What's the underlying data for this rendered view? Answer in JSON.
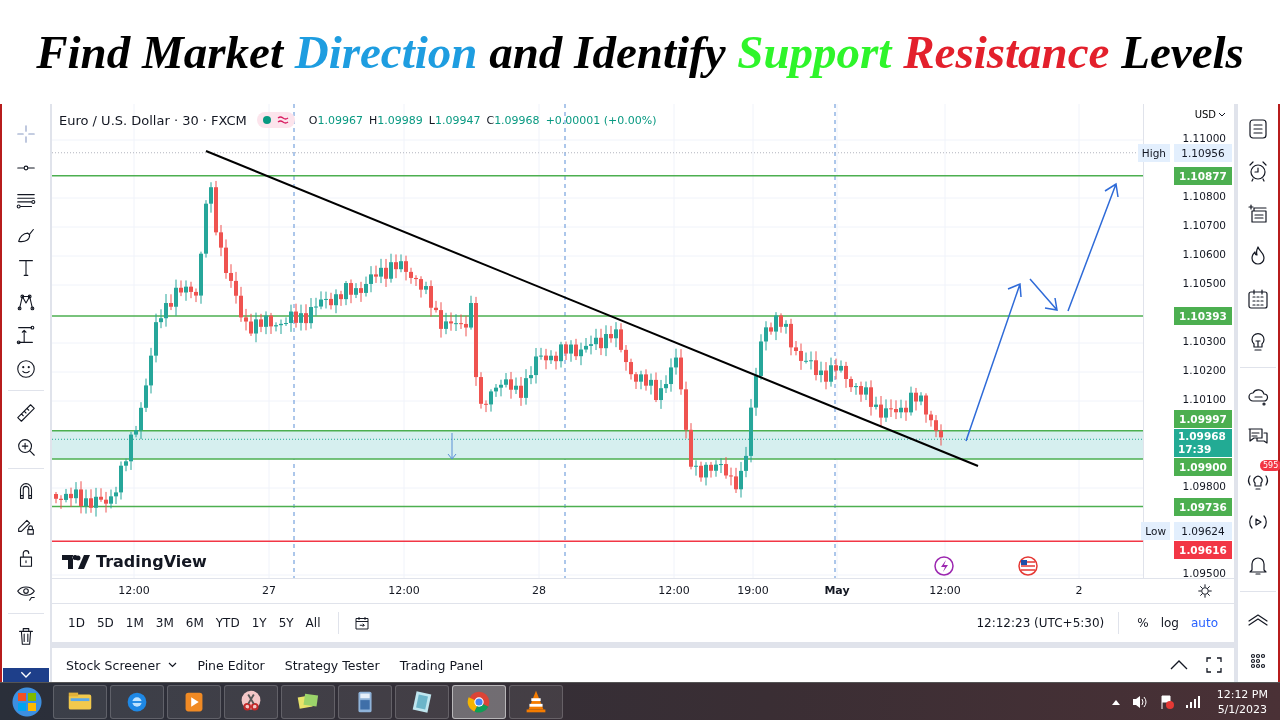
{
  "headline": [
    {
      "text": "Find Market",
      "color": "#000000"
    },
    {
      "text": "Direction",
      "color": "#1e9de0"
    },
    {
      "text": "and Identify",
      "color": "#000000"
    },
    {
      "text": "Support",
      "color": "#2ef52a"
    },
    {
      "text": "Resistance",
      "color": "#e3202c"
    },
    {
      "text": "Levels",
      "color": "#000000"
    }
  ],
  "chart": {
    "symbol": "Euro / U.S. Dollar · 30 · FXCM",
    "ohlc": [
      {
        "label": "O",
        "value": "1.09967"
      },
      {
        "label": "H",
        "value": "1.09989"
      },
      {
        "label": "L",
        "value": "1.09947"
      },
      {
        "label": "C",
        "value": "1.09968"
      }
    ],
    "change": "+0.00001 (+0.00%)",
    "currency": "USD",
    "logo": "TradingView",
    "price_ticks": [
      "1.11000",
      "1.10800",
      "1.10700",
      "1.10600",
      "1.10500",
      "1.10300",
      "1.10200",
      "1.10100",
      "1.09800",
      "1.09500"
    ],
    "price_labels": [
      {
        "kind": "high",
        "tag": "High",
        "price": "1.10956"
      },
      {
        "kind": "line",
        "price": "1.10877",
        "color": "#4caf50"
      },
      {
        "kind": "line",
        "price": "1.10393",
        "color": "#4caf50"
      },
      {
        "kind": "line",
        "price": "1.09997",
        "color": "#4caf50"
      },
      {
        "kind": "current",
        "price": "1.09968",
        "countdown": "17:39"
      },
      {
        "kind": "line",
        "price": "1.09900",
        "color": "#4caf50"
      },
      {
        "kind": "line",
        "price": "1.09736",
        "color": "#4caf50"
      },
      {
        "kind": "low",
        "tag": "Low",
        "price": "1.09624"
      },
      {
        "kind": "line",
        "price": "1.09616",
        "color": "#f23645"
      }
    ],
    "time_labels": [
      {
        "kind": "time",
        "text": "12:00"
      },
      {
        "kind": "day",
        "text": "27"
      },
      {
        "kind": "time",
        "text": "12:00"
      },
      {
        "kind": "day",
        "text": "28"
      },
      {
        "kind": "time",
        "text": "12:00"
      },
      {
        "kind": "time",
        "text": "19:00"
      },
      {
        "kind": "month",
        "text": "May"
      },
      {
        "kind": "time",
        "text": "12:00"
      },
      {
        "kind": "day",
        "text": "2"
      }
    ]
  },
  "ranges": [
    "1D",
    "5D",
    "1M",
    "3M",
    "6M",
    "YTD",
    "1Y",
    "5Y",
    "All"
  ],
  "clock": "12:12:23 (UTC+5:30)",
  "scale_options": [
    {
      "label": "%",
      "selected": false
    },
    {
      "label": "log",
      "selected": false
    },
    {
      "label": "auto",
      "selected": true
    }
  ],
  "alerts_badge": "595",
  "bottom_tabs": [
    {
      "label": "Stock Screener",
      "dropdown": true
    },
    {
      "label": "Pine Editor",
      "dropdown": false
    },
    {
      "label": "Strategy Tester",
      "dropdown": false
    },
    {
      "label": "Trading Panel",
      "dropdown": false
    }
  ],
  "taskbar": {
    "apps": [
      {
        "kind": "folder",
        "selected": false
      },
      {
        "kind": "browser-e",
        "selected": false
      },
      {
        "kind": "media",
        "selected": false
      },
      {
        "kind": "scissors",
        "selected": false
      },
      {
        "kind": "notes",
        "selected": false
      },
      {
        "kind": "calculator",
        "selected": false
      },
      {
        "kind": "notepad",
        "selected": false
      },
      {
        "kind": "chrome",
        "selected": true
      },
      {
        "kind": "cone",
        "selected": false
      }
    ],
    "time": "12:12 PM",
    "date": "5/1/2023"
  }
}
